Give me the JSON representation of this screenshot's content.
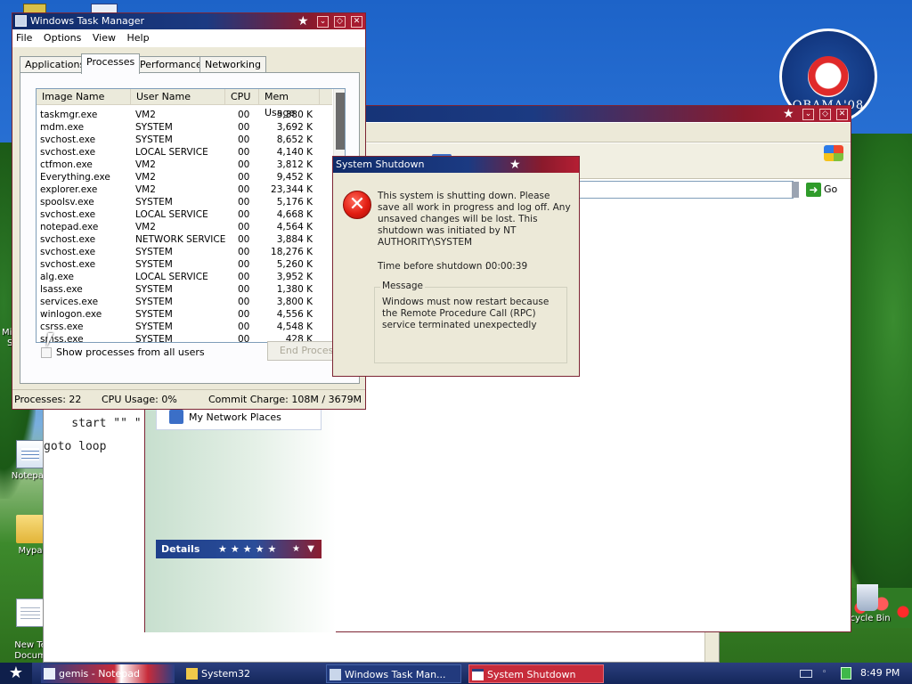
{
  "desktop": {
    "logo_text": "OBAMA'08",
    "icons": [
      {
        "label": "Notepad",
        "icon": "notepad-icon"
      },
      {
        "label": "Mypa",
        "icon": "folder-icon"
      },
      {
        "label": "New Te\nDocum",
        "icon": "text-document-icon"
      },
      {
        "label": "ecycle Bin",
        "icon": "recycle-bin-icon"
      }
    ],
    "partial_label_mi": "Mi",
    "partial_label_s": "S"
  },
  "browser": {
    "go_label": "Go"
  },
  "taskpane": {
    "my_network_places": "My Network Places",
    "details_label": "Details"
  },
  "notepad_bg": {
    "line1": "    start \"\" \"",
    "line2": "goto loop"
  },
  "task_manager": {
    "title": "Windows Task Manager",
    "menu": [
      "File",
      "Options",
      "View",
      "Help"
    ],
    "tabs": [
      "Applications",
      "Processes",
      "Performance",
      "Networking"
    ],
    "active_tab": "Processes",
    "columns": [
      "Image Name",
      "User Name",
      "CPU",
      "Mem Usage"
    ],
    "rows": [
      [
        "taskmgr.exe",
        "VM2",
        "00",
        "5,380 K"
      ],
      [
        "mdm.exe",
        "SYSTEM",
        "00",
        "3,692 K"
      ],
      [
        "svchost.exe",
        "SYSTEM",
        "00",
        "8,652 K"
      ],
      [
        "svchost.exe",
        "LOCAL SERVICE",
        "00",
        "4,140 K"
      ],
      [
        "ctfmon.exe",
        "VM2",
        "00",
        "3,812 K"
      ],
      [
        "Everything.exe",
        "VM2",
        "00",
        "9,452 K"
      ],
      [
        "explorer.exe",
        "VM2",
        "00",
        "23,344 K"
      ],
      [
        "spoolsv.exe",
        "SYSTEM",
        "00",
        "5,176 K"
      ],
      [
        "svchost.exe",
        "LOCAL SERVICE",
        "00",
        "4,668 K"
      ],
      [
        "notepad.exe",
        "VM2",
        "00",
        "4,564 K"
      ],
      [
        "svchost.exe",
        "NETWORK SERVICE",
        "00",
        "3,884 K"
      ],
      [
        "svchost.exe",
        "SYSTEM",
        "00",
        "18,276 K"
      ],
      [
        "svchost.exe",
        "SYSTEM",
        "00",
        "5,260 K"
      ],
      [
        "alg.exe",
        "LOCAL SERVICE",
        "00",
        "3,952 K"
      ],
      [
        "lsass.exe",
        "SYSTEM",
        "00",
        "1,380 K"
      ],
      [
        "services.exe",
        "SYSTEM",
        "00",
        "3,800 K"
      ],
      [
        "winlogon.exe",
        "SYSTEM",
        "00",
        "4,556 K"
      ],
      [
        "csrss.exe",
        "SYSTEM",
        "00",
        "4,548 K"
      ],
      [
        "smss.exe",
        "SYSTEM",
        "00",
        "428 K"
      ]
    ],
    "show_all_label": "Show processes from all users",
    "end_process_label": "End Process",
    "status": {
      "processes": "Processes: 22",
      "cpu": "CPU Usage: 0%",
      "commit": "Commit Charge: 108M / 3679M"
    }
  },
  "shutdown_dialog": {
    "title": "System Shutdown",
    "message": "This system is shutting down. Please save all work in progress and log off. Any unsaved changes will be lost. This shutdown was initiated by NT AUTHORITY\\SYSTEM",
    "time_label": "Time before shutdown :",
    "time_value": "00:00:39",
    "group_label": "Message",
    "group_text": "Windows must now restart because the Remote Procedure Call (RPC) service terminated unexpectedly"
  },
  "taskbar": {
    "items": [
      {
        "label": "gemis - Notepad",
        "icon": "notepad-icon"
      },
      {
        "label": "System32",
        "icon": "folder-icon"
      },
      {
        "label": "Windows Task Man...",
        "icon": "task-manager-icon"
      },
      {
        "label": "System Shutdown",
        "icon": "window-icon"
      }
    ],
    "clock": "8:49 PM"
  },
  "colors": {
    "title_blue": "#102b69",
    "title_red": "#b51e33",
    "window_face": "#ece9d8",
    "error_red": "#e21d12"
  }
}
